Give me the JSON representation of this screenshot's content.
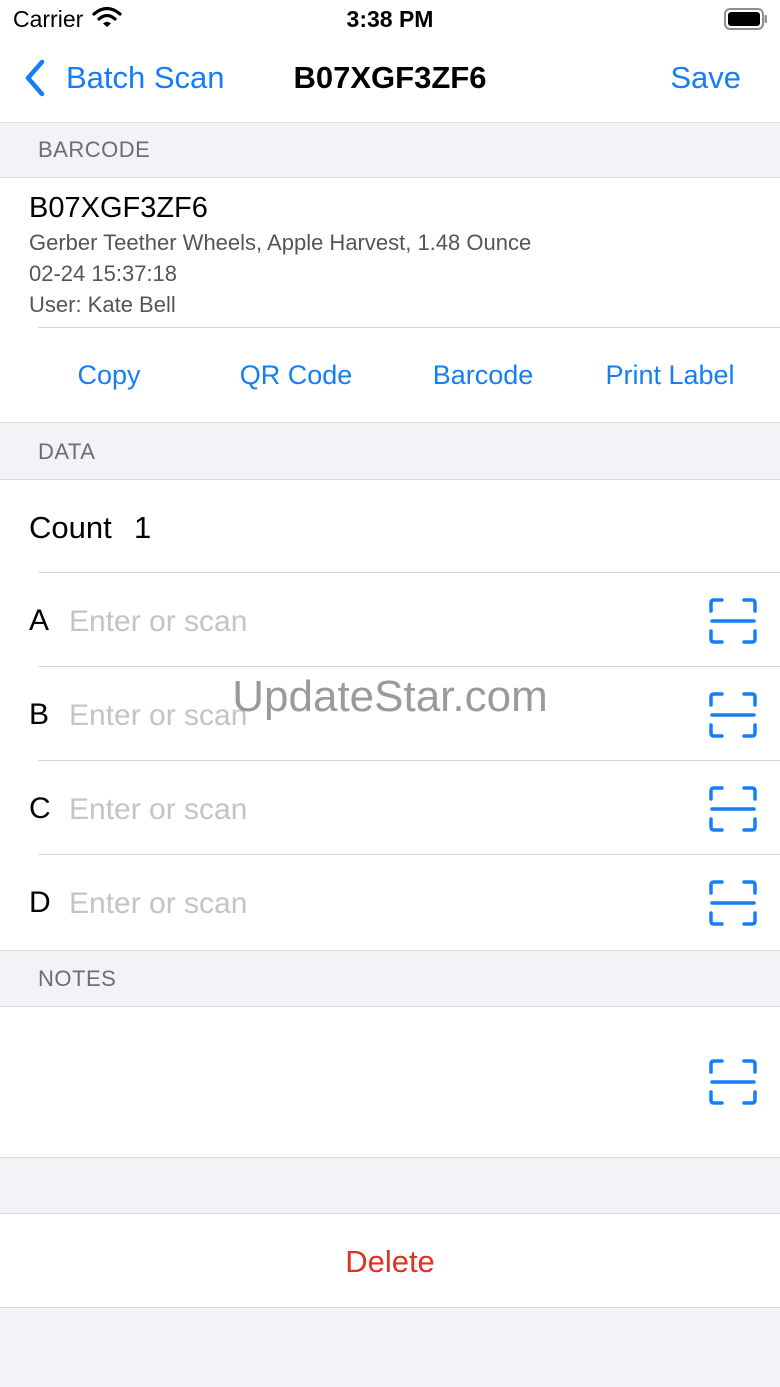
{
  "status_bar": {
    "carrier": "Carrier",
    "time": "3:38 PM",
    "icons": [
      "wifi-icon",
      "battery-icon"
    ]
  },
  "nav": {
    "back_label": "Batch Scan",
    "title": "B07XGF3ZF6",
    "save_label": "Save"
  },
  "barcode_section": {
    "header": "BARCODE",
    "code": "B07XGF3ZF6",
    "description": "Gerber Teether Wheels, Apple Harvest, 1.48 Ounce",
    "timestamp": "02-24 15:37:18",
    "user": "User: Kate Bell",
    "actions": [
      "Copy",
      "QR Code",
      "Barcode",
      "Print Label"
    ]
  },
  "data_section": {
    "header": "DATA",
    "count_label": "Count",
    "count_value": "1",
    "fields": [
      {
        "label": "A",
        "value": "",
        "placeholder": "Enter or scan"
      },
      {
        "label": "B",
        "value": "",
        "placeholder": "Enter or scan"
      },
      {
        "label": "C",
        "value": "",
        "placeholder": "Enter or scan"
      },
      {
        "label": "D",
        "value": "",
        "placeholder": "Enter or scan"
      }
    ]
  },
  "notes_section": {
    "header": "NOTES",
    "value": ""
  },
  "delete_label": "Delete",
  "watermark": "UpdateStar.com",
  "colors": {
    "accent": "#157ef6",
    "destructive": "#e0321f",
    "background": "#f2f2f7",
    "placeholder": "#c4c4c6"
  }
}
